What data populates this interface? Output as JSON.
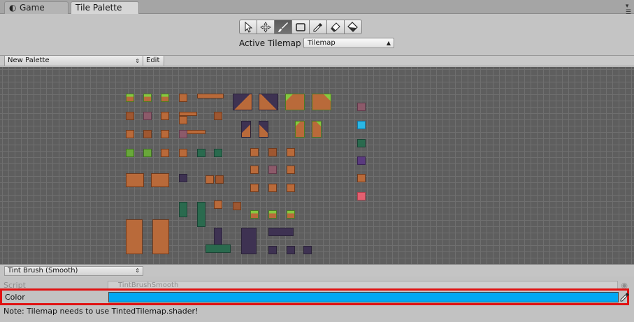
{
  "tabs": [
    {
      "label": "Game",
      "icon": "pacman-game-icon"
    },
    {
      "label": "Tile Palette"
    }
  ],
  "tools": [
    {
      "name": "select-tool",
      "icon": "arrow-cursor-icon"
    },
    {
      "name": "move-tool",
      "icon": "move-arrows-icon"
    },
    {
      "name": "paint-tool",
      "icon": "paintbrush-icon",
      "selected": true
    },
    {
      "name": "box-fill-tool",
      "icon": "rectangle-icon"
    },
    {
      "name": "picker-tool",
      "icon": "eyedropper-icon"
    },
    {
      "name": "eraser-tool",
      "icon": "eraser-icon"
    },
    {
      "name": "fill-tool",
      "icon": "paint-bucket-icon"
    }
  ],
  "active_tilemap": {
    "label": "Active Tilemap",
    "value": "Tilemap"
  },
  "palette": {
    "selected": "New Palette",
    "edit_label": "Edit"
  },
  "brush": {
    "selected": "Tint Brush (Smooth)"
  },
  "inspector": {
    "script_label": "Script",
    "script_value": "TintBrushSmooth",
    "color_label": "Color",
    "color_value": "#00A8F4",
    "note": "Note: Tilemap needs to use TintedTilemap.shader!"
  },
  "colors": {
    "highlight_border": "#E01212",
    "tint_color": "#00A8F4",
    "grid_background": "#5E5E5E"
  }
}
